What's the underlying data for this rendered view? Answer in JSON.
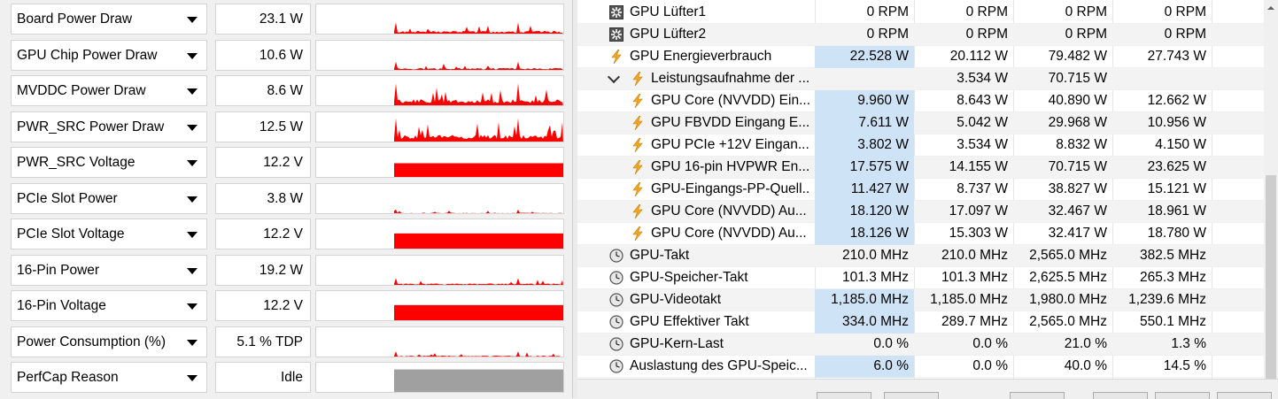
{
  "gpuz": {
    "sensors": [
      {
        "name": "Board Power Draw",
        "value": "23.1 W",
        "graph": "spiky",
        "level": 0.16
      },
      {
        "name": "GPU Chip Power Draw",
        "value": "10.6 W",
        "graph": "spiky",
        "level": 0.12
      },
      {
        "name": "MVDDC Power Draw",
        "value": "8.6 W",
        "graph": "spiky",
        "level": 0.3
      },
      {
        "name": "PWR_SRC Power Draw",
        "value": "12.5 W",
        "graph": "spiky",
        "level": 0.32
      },
      {
        "name": "PWR_SRC Voltage",
        "value": "12.2 V",
        "graph": "full",
        "level": 0.5
      },
      {
        "name": "PCIe Slot Power",
        "value": "3.8 W",
        "graph": "spiky",
        "level": 0.06
      },
      {
        "name": "PCIe Slot Voltage",
        "value": "12.2 V",
        "graph": "full",
        "level": 0.55
      },
      {
        "name": "16-Pin Power",
        "value": "19.2 W",
        "graph": "spiky",
        "level": 0.1
      },
      {
        "name": "16-Pin Voltage",
        "value": "12.2 V",
        "graph": "full",
        "level": 0.55
      },
      {
        "name": "Power Consumption (%)",
        "value": "5.1 % TDP",
        "graph": "spiky",
        "level": 0.08
      },
      {
        "name": "PerfCap Reason",
        "value": "Idle",
        "graph": "gray",
        "level": 0.8
      }
    ],
    "graph_color": "#ff0000",
    "perfcap_color": "#a0a0a0"
  },
  "hwinfo": {
    "rows": [
      {
        "icon": "fan-icon",
        "name": "GPU Lüfter1",
        "v": [
          "0 RPM",
          "0 RPM",
          "0 RPM",
          "0 RPM"
        ],
        "hl": false,
        "indent": 0
      },
      {
        "icon": "fan-icon",
        "name": "GPU Lüfter2",
        "v": [
          "0 RPM",
          "0 RPM",
          "0 RPM",
          "0 RPM"
        ],
        "hl": false,
        "indent": 0
      },
      {
        "icon": "lightning-icon",
        "name": "GPU Energieverbrauch",
        "v": [
          "22.528 W",
          "20.112 W",
          "79.482 W",
          "27.743 W"
        ],
        "hl": true,
        "indent": 0
      },
      {
        "icon": "lightning-icon",
        "name": "Leistungsaufnahme der ...",
        "v": [
          "",
          "3.534 W",
          "70.715 W",
          ""
        ],
        "hl": false,
        "indent": 1,
        "expander": true
      },
      {
        "icon": "lightning-icon",
        "name": "GPU Core (NVVDD) Ein...",
        "v": [
          "9.960 W",
          "8.643 W",
          "40.890 W",
          "12.662 W"
        ],
        "hl": true,
        "indent": 1
      },
      {
        "icon": "lightning-icon",
        "name": "GPU FBVDD Eingang E...",
        "v": [
          "7.611 W",
          "5.042 W",
          "29.968 W",
          "10.956 W"
        ],
        "hl": true,
        "indent": 1
      },
      {
        "icon": "lightning-icon",
        "name": "GPU PCIe +12V Eingan...",
        "v": [
          "3.802 W",
          "3.534 W",
          "8.832 W",
          "4.150 W"
        ],
        "hl": true,
        "indent": 1
      },
      {
        "icon": "lightning-icon",
        "name": "GPU 16-pin HVPWR En...",
        "v": [
          "17.575 W",
          "14.155 W",
          "70.715 W",
          "23.625 W"
        ],
        "hl": true,
        "indent": 1
      },
      {
        "icon": "lightning-icon",
        "name": "GPU-Eingangs-PP-Quell...",
        "v": [
          "11.427 W",
          "8.737 W",
          "38.827 W",
          "15.121 W"
        ],
        "hl": true,
        "indent": 1
      },
      {
        "icon": "lightning-icon",
        "name": "GPU Core (NVVDD) Au...",
        "v": [
          "18.120 W",
          "17.097 W",
          "32.467 W",
          "18.961 W"
        ],
        "hl": true,
        "indent": 1
      },
      {
        "icon": "lightning-icon",
        "name": "GPU Core (NVVDD) Au...",
        "v": [
          "18.126 W",
          "15.303 W",
          "32.417 W",
          "18.780 W"
        ],
        "hl": true,
        "indent": 1
      },
      {
        "icon": "clock-icon",
        "name": "GPU-Takt",
        "v": [
          "210.0 MHz",
          "210.0 MHz",
          "2,565.0 MHz",
          "382.5 MHz"
        ],
        "hl": false,
        "indent": 0
      },
      {
        "icon": "clock-icon",
        "name": "GPU-Speicher-Takt",
        "v": [
          "101.3 MHz",
          "101.3 MHz",
          "2,625.5 MHz",
          "265.3 MHz"
        ],
        "hl": false,
        "indent": 0
      },
      {
        "icon": "clock-icon",
        "name": "GPU-Videotakt",
        "v": [
          "1,185.0 MHz",
          "1,185.0 MHz",
          "1,980.0 MHz",
          "1,239.6 MHz"
        ],
        "hl": true,
        "indent": 0
      },
      {
        "icon": "clock-icon",
        "name": "GPU Effektiver Takt",
        "v": [
          "334.0 MHz",
          "289.7 MHz",
          "2,565.0 MHz",
          "550.1 MHz"
        ],
        "hl": true,
        "indent": 0
      },
      {
        "icon": "clock-icon",
        "name": "GPU-Kern-Last",
        "v": [
          "0.0 %",
          "0.0 %",
          "21.0 %",
          "1.3 %"
        ],
        "hl": false,
        "indent": 0
      },
      {
        "icon": "clock-icon",
        "name": "Auslastung des GPU-Speic...",
        "v": [
          "6.0 %",
          "0.0 %",
          "40.0 %",
          "14.5 %"
        ],
        "hl": true,
        "indent": 0
      }
    ],
    "highlight_color": "#cfe3f7",
    "lightning_color": "#f5a623"
  }
}
